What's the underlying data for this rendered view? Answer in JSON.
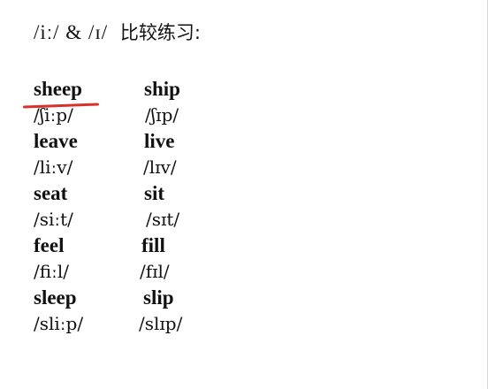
{
  "title": {
    "phonetics": "/iː/ & /ɪ/",
    "chinese": "比较练习:"
  },
  "pairs": [
    {
      "word_long": "sheep",
      "ipa_long": "/ʃiːp/",
      "word_short": "ship",
      "ipa_short": "/ʃɪp/"
    },
    {
      "word_long": "leave",
      "ipa_long": "/liːv/",
      "word_short": "live",
      "ipa_short": "/lɪv/"
    },
    {
      "word_long": "seat",
      "ipa_long": "/siːt/",
      "word_short": "sit",
      "ipa_short": "/sɪt/"
    },
    {
      "word_long": "feel",
      "ipa_long": "/fiːl/",
      "word_short": "fill",
      "ipa_short": "/fɪl/"
    },
    {
      "word_long": "sleep",
      "ipa_long": "/sliːp/",
      "word_short": "slip",
      "ipa_short": "/slɪp/"
    }
  ],
  "annotation": {
    "color": "#d9302c"
  }
}
